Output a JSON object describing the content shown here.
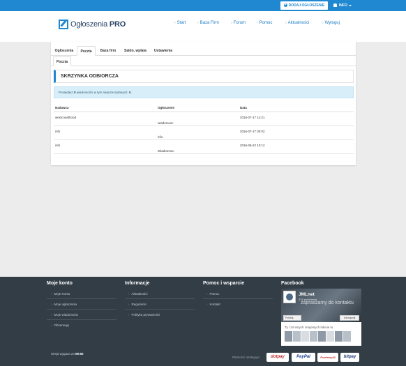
{
  "topbar": {
    "add_button": "DODAJ OGŁOSZENIE",
    "info_menu": "INFO"
  },
  "header": {
    "logo_prefix": "Ogłoszenia",
    "logo_suffix": "PRO",
    "nav": [
      "Start",
      "Baza Firm",
      "Forum",
      "Pomoc",
      "Aktualności",
      "Wyloguj"
    ]
  },
  "tabs": [
    "Ogłoszenia",
    "Poczta",
    "Baza firm",
    "Saldo, wpłata",
    "Ustawienia"
  ],
  "active_tab": "Poczta",
  "subtab": "Poczta",
  "inbox": {
    "title": "SKRZYNKA ODBIORCZA",
    "alert_prefix": "Posiadasz",
    "alert_count": "8",
    "alert_middle": "wiadomości w tym nieprzeczytanych:",
    "alert_unread": "0.",
    "columns": [
      "Nadawca",
      "Ogłoszenie",
      "Data"
    ],
    "rows": [
      {
        "sender": "westcoasthood",
        "ad": "wiadomosc",
        "date": "2016-07-17 14:21"
      },
      {
        "sender": "info",
        "ad": "info",
        "date": "2016-07-17 00:02"
      },
      {
        "sender": "info",
        "ad": "Wiadomosc",
        "date": "2016-06-22 10:12"
      }
    ]
  },
  "footer": {
    "col1": {
      "heading": "Moje konto",
      "links": [
        "Moje Konto",
        "Moje ogłoszenia",
        "Moje wiadomości",
        "Obserwuję"
      ]
    },
    "col2": {
      "heading": "Informacje",
      "links": [
        "Aktualności",
        "Regulamin",
        "Polityka prywatności"
      ]
    },
    "col3": {
      "heading": "Pomoc i wsparcie",
      "links": [
        "Pomoc",
        "Kontakt"
      ]
    },
    "col4": {
      "heading": "Facebook"
    },
    "facebook": {
      "page_name": "JMLnet",
      "likes": "378 polubienia",
      "overlay": "zapraszamy do kontaktu",
      "like_button": "Polubię",
      "share_button": "Udostępnij",
      "friends_text": "Ty i 24 innych znajomych lubicie to"
    },
    "session_label": "Sesja wygasa za",
    "session_time": "09:50",
    "payments_label": "Płatności obsługuje:",
    "payments": [
      "dotpay",
      "PayPal",
      "Przelewy24",
      "bitpay"
    ]
  },
  "colors": {
    "accent": "#1f88d0",
    "footer_bg": "#323d46",
    "alert_bg": "#d8eef9"
  }
}
